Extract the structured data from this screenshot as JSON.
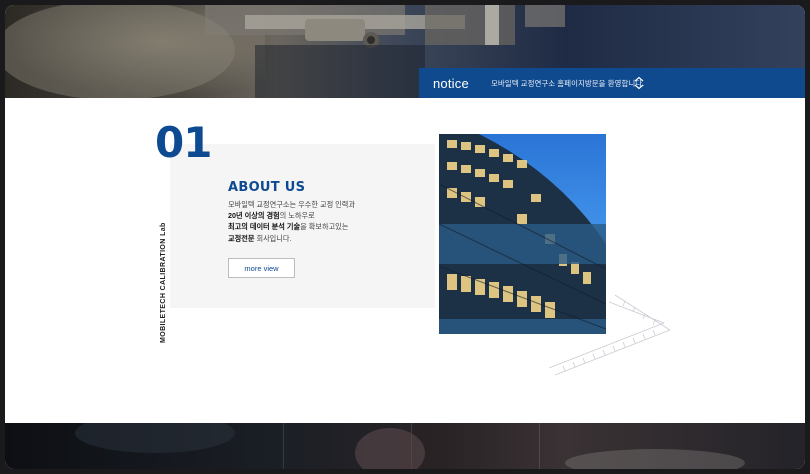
{
  "notice": {
    "title": "notice",
    "message": "모바일텍 교정연구소 홈페이지방문을 환영합니다."
  },
  "about": {
    "number": "01",
    "side_label": "MOBILETECH CALIBRATION Lab",
    "title": "ABOUT US",
    "line1": "모바일텍 교정연구소는 우수한 교정 인력과",
    "line2_bold": "20년 이상의 경험",
    "line2_rest": "의 노하우로",
    "line3_bold": "최고의 데이터 분석 기술",
    "line3_rest": "을 확보하고있는",
    "line4_bold": "교정전문",
    "line4_rest": " 회사입니다.",
    "button_label": "more view"
  },
  "colors": {
    "accent": "#0d4a92",
    "notice_bar": "#0f4a8f",
    "box": "#f5f5f5"
  },
  "icons": {
    "notice_arrows": "chevron-up-down-icon"
  }
}
